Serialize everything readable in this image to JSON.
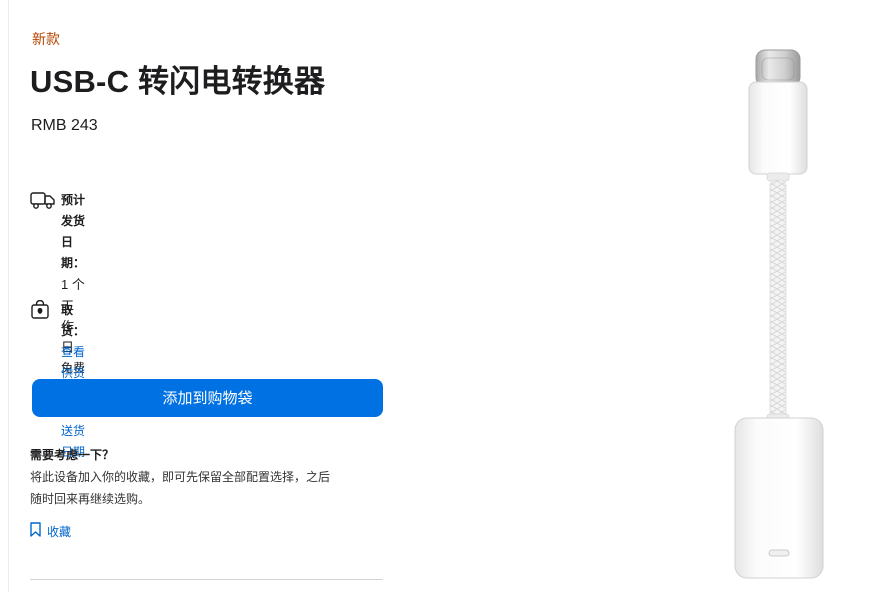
{
  "product": {
    "new_label": "新款",
    "title": "USB-C 转闪电转换器",
    "price": "RMB 243"
  },
  "delivery": {
    "icon": "truck-icon",
    "heading": "预计发货日期：",
    "days": "1 个工作日",
    "shipping": "免费送货",
    "link": "查看送货日期"
  },
  "pickup": {
    "icon": "store-bag-icon",
    "heading": "取货：",
    "link": "查看供货情况"
  },
  "add_to_bag": "添加到购物袋",
  "consider": {
    "heading": "需要考虑一下？",
    "desc_line1": "将此设备加入你的收藏，即可先保留全部配置选择，之后",
    "desc_line2": "随时回来再继续选购。"
  },
  "save": {
    "icon": "bookmark-icon",
    "label": "收藏"
  },
  "colors": {
    "accent": "#0071e3",
    "link": "#0066cc",
    "new_label": "#b64400"
  }
}
